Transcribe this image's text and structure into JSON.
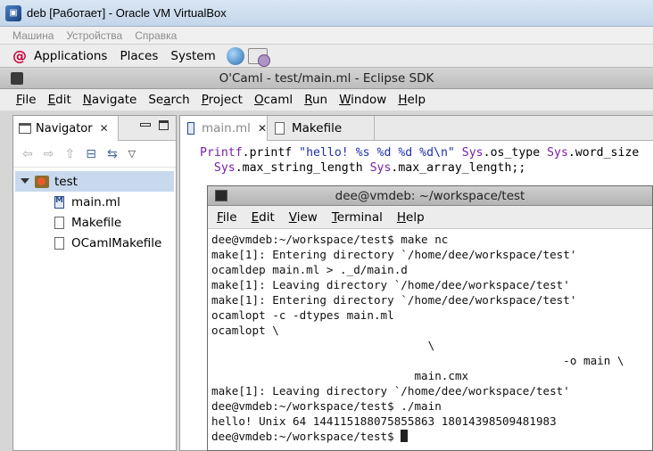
{
  "host": {
    "title": "deb [Работает] - Oracle VM VirtualBox",
    "menu": [
      "Машина",
      "Устройства",
      "Справка"
    ]
  },
  "panel": {
    "items": [
      "Applications",
      "Places",
      "System"
    ]
  },
  "eclipse": {
    "title": "O'Caml - test/main.ml - Eclipse SDK",
    "menu": [
      {
        "u": "F",
        "rest": "ile"
      },
      {
        "u": "E",
        "rest": "dit"
      },
      {
        "u": "N",
        "rest": "avigate"
      },
      {
        "pre": "Se",
        "u": "a",
        "rest": "rch"
      },
      {
        "u": "P",
        "rest": "roject"
      },
      {
        "u": "O",
        "rest": "caml"
      },
      {
        "u": "R",
        "rest": "un"
      },
      {
        "u": "W",
        "rest": "indow"
      },
      {
        "u": "H",
        "rest": "elp"
      }
    ]
  },
  "navigator": {
    "tab_label": "Navigator",
    "project": "test",
    "files": [
      "main.ml",
      "Makefile",
      "OCamlMakefile"
    ]
  },
  "editor": {
    "tabs": [
      "main.ml",
      "Makefile"
    ],
    "code": {
      "l1_mod1": "Printf",
      "l1_a": ".printf ",
      "l1_str": "\"hello! %s %d %d %d\\n\"",
      "l1_mod2": "Sys",
      "l1_b": ".os_type ",
      "l1_mod3": "Sys",
      "l1_c": ".word_size",
      "l2_mod1": "Sys",
      "l2_a": ".max_string_length ",
      "l2_mod2": "Sys",
      "l2_b": ".max_array_length;;"
    }
  },
  "terminal": {
    "title": "dee@vmdeb: ~/workspace/test",
    "menu": [
      {
        "u": "F",
        "rest": "ile"
      },
      {
        "u": "E",
        "rest": "dit"
      },
      {
        "u": "V",
        "rest": "iew"
      },
      {
        "u": "T",
        "rest": "erminal"
      },
      {
        "u": "H",
        "rest": "elp"
      }
    ],
    "lines": [
      "dee@vmdeb:~/workspace/test$ make nc",
      "make[1]: Entering directory `/home/dee/workspace/test'",
      "ocamldep main.ml > ._d/main.d",
      "make[1]: Leaving directory `/home/dee/workspace/test'",
      "make[1]: Entering directory `/home/dee/workspace/test'",
      "ocamlopt -c -dtypes main.ml",
      "ocamlopt \\",
      "                                \\",
      "                                                    -o main \\",
      "                              main.cmx",
      "make[1]: Leaving directory `/home/dee/workspace/test'",
      "dee@vmdeb:~/workspace/test$ ./main",
      "hello! Unix 64 144115188075855863 18014398509481983",
      "dee@vmdeb:~/workspace/test$ "
    ]
  }
}
